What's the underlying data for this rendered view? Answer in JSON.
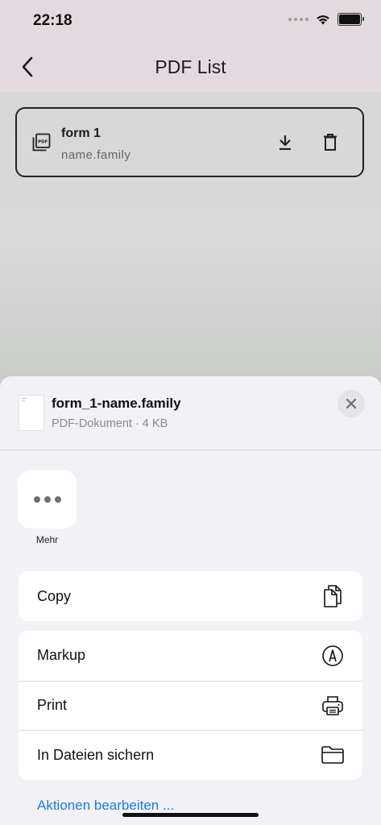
{
  "status_bar": {
    "time": "22:18"
  },
  "app_bar": {
    "title": "PDF List"
  },
  "pdf_item": {
    "title": "form 1",
    "subtitle": "name.family"
  },
  "share_sheet": {
    "file_name": "form_1-name.family",
    "file_meta": "PDF-Dokument · 4 KB",
    "more_label": "Mehr",
    "actions_group1": [
      {
        "label": "Copy",
        "icon": "copy-icon"
      }
    ],
    "actions_group2": [
      {
        "label": "Markup",
        "icon": "markup-icon"
      },
      {
        "label": "Print",
        "icon": "print-icon"
      },
      {
        "label": "In Dateien sichern",
        "icon": "folder-icon"
      }
    ],
    "edit_actions": "Aktionen bearbeiten ..."
  },
  "colors": {
    "accent": "#1a7ae8",
    "app_bar": "#e3dadf",
    "sheet_bg": "#f2f2f6"
  }
}
